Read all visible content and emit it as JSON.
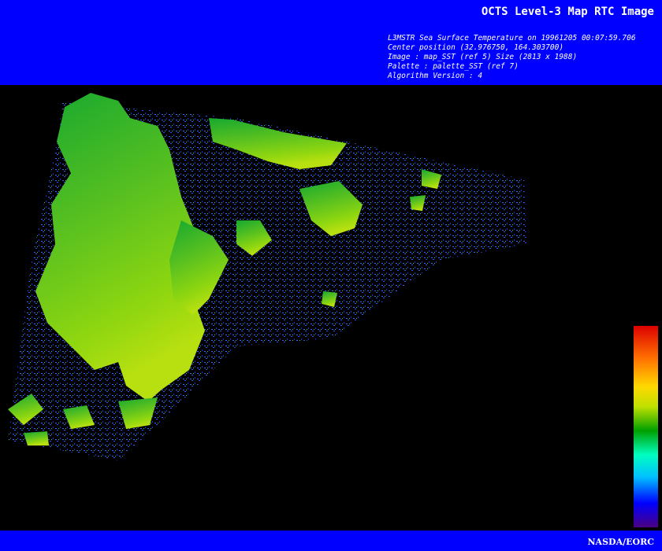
{
  "header": {
    "title": "OCTS Level-3 Map RTC Image",
    "meta_lines": [
      "L3MSTR Sea Surface Temperature on 19961205 00:07:59.706",
      "Center position (32.976750, 164.303700)",
      "Image : map_SST (ref 5) Size (2813 x 1988)",
      "Palette : palette_SST (ref 7)",
      "Algorithm Version : 4"
    ]
  },
  "footer": {
    "credit": "NASDA/EORC"
  },
  "colors": {
    "band": "#0000ff",
    "background": "#000000",
    "palette": [
      "#4b0082",
      "#0000ff",
      "#00c0ff",
      "#00ffc0",
      "#00a000",
      "#c0e000",
      "#ffd800",
      "#ff7000",
      "#dd0000"
    ]
  }
}
